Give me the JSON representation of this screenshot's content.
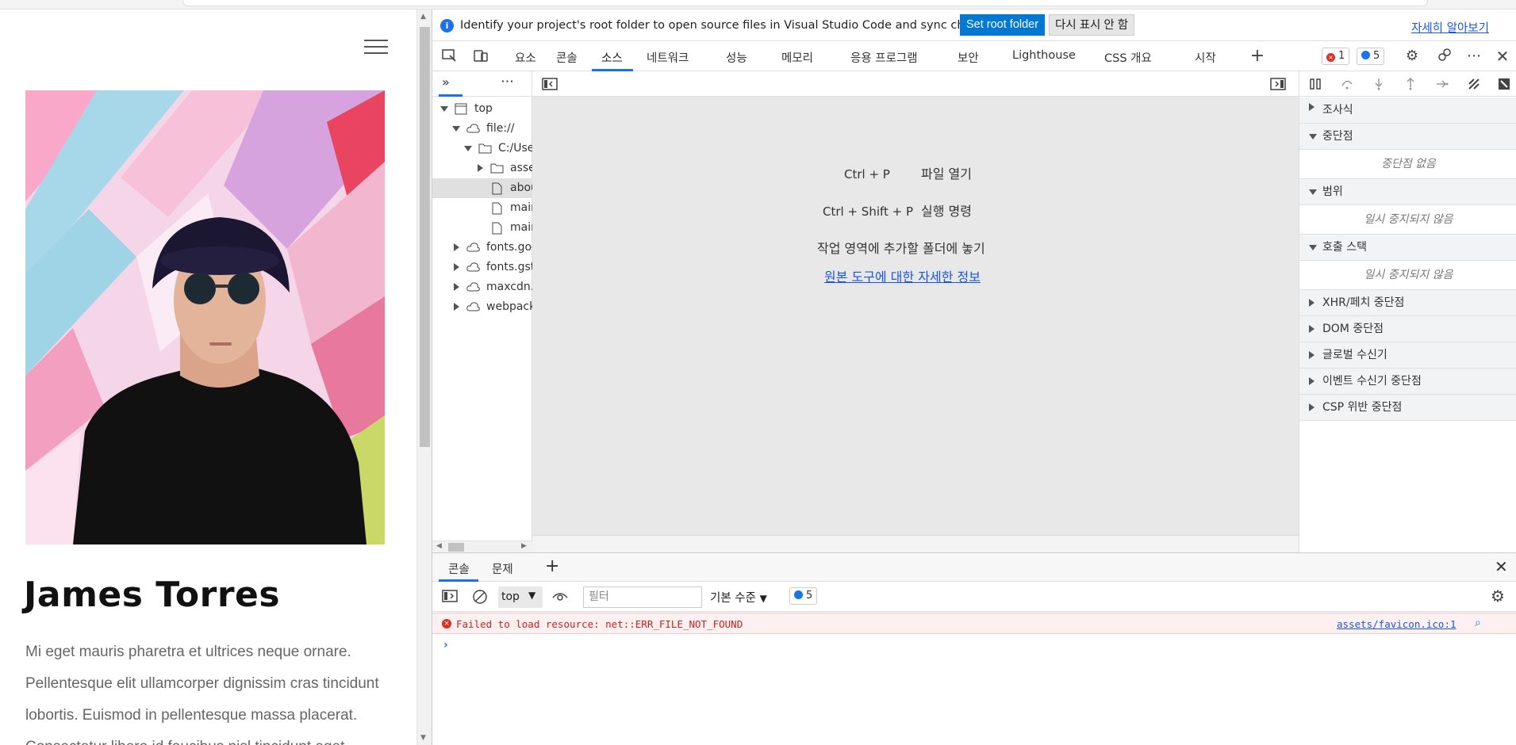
{
  "page": {
    "name": "James Torres",
    "bio_lines": [
      "Mi eget mauris pharetra et ultrices neque ornare.",
      "Pellentesque elit ullamcorper dignissim cras tincidunt",
      "lobortis. Euismod in pellentesque massa placerat.",
      "Consectetur libero id faucibus nisl tincidunt eget"
    ]
  },
  "infobar": {
    "message": "Identify your project's root folder to open source files in Visual Studio Code and sync changes.",
    "set_root": "Set root folder",
    "dismiss": "다시 표시 안 함",
    "learn_more": "자세히 알아보기"
  },
  "tabs": [
    "요소",
    "콘솔",
    "소스",
    "네트워크",
    "성능",
    "메모리",
    "응용 프로그램",
    "보안",
    "Lighthouse",
    "CSS 개요",
    "시작"
  ],
  "active_tab": "소스",
  "badges": {
    "errors": "1",
    "messages": "5"
  },
  "tree": [
    {
      "label": "top"
    },
    {
      "label": "file://"
    },
    {
      "label": "C:/Users"
    },
    {
      "label": "assets"
    },
    {
      "label": "about"
    },
    {
      "label": "main"
    },
    {
      "label": "main"
    },
    {
      "label": "fonts.googleapis"
    },
    {
      "label": "fonts.gstatic"
    },
    {
      "label": "maxcdn."
    },
    {
      "label": "webpack"
    }
  ],
  "shortcuts": {
    "ctrl_p": "Ctrl + P",
    "open_file": "파일 열기",
    "ctrl_shift_p": "Ctrl + Shift + P",
    "run_command": "실행 명령",
    "drop_folder": "작업 영역에 추가할 폴더에 놓기",
    "learn_more": "원본 도구에 대한 자세한 정보"
  },
  "debugger": {
    "watch": "조사식",
    "breakpoints": "중단점",
    "no_breakpoints": "중단점 없음",
    "scope": "범위",
    "not_paused": "일시 중지되지 않음",
    "call_stack": "호출 스택",
    "not_paused2": "일시 중지되지 않음",
    "xhr": "XHR/페치 중단점",
    "dom": "DOM 중단점",
    "global": "글로벌 수신기",
    "event": "이벤트 수신기 중단점",
    "csp": "CSP 위반 중단점"
  },
  "drawer": {
    "tab_console": "콘솔",
    "tab_issues": "문제",
    "context": "top",
    "filter_placeholder": "필터",
    "level": "기본 수준",
    "msg_count": "5",
    "error_text": "Failed to load resource: net::ERR_FILE_NOT_FOUND",
    "error_source": "assets/favicon.ico:1"
  },
  "colors": {
    "accent": "#1a73e8",
    "error": "#c5221f",
    "button": "#0078d4"
  }
}
